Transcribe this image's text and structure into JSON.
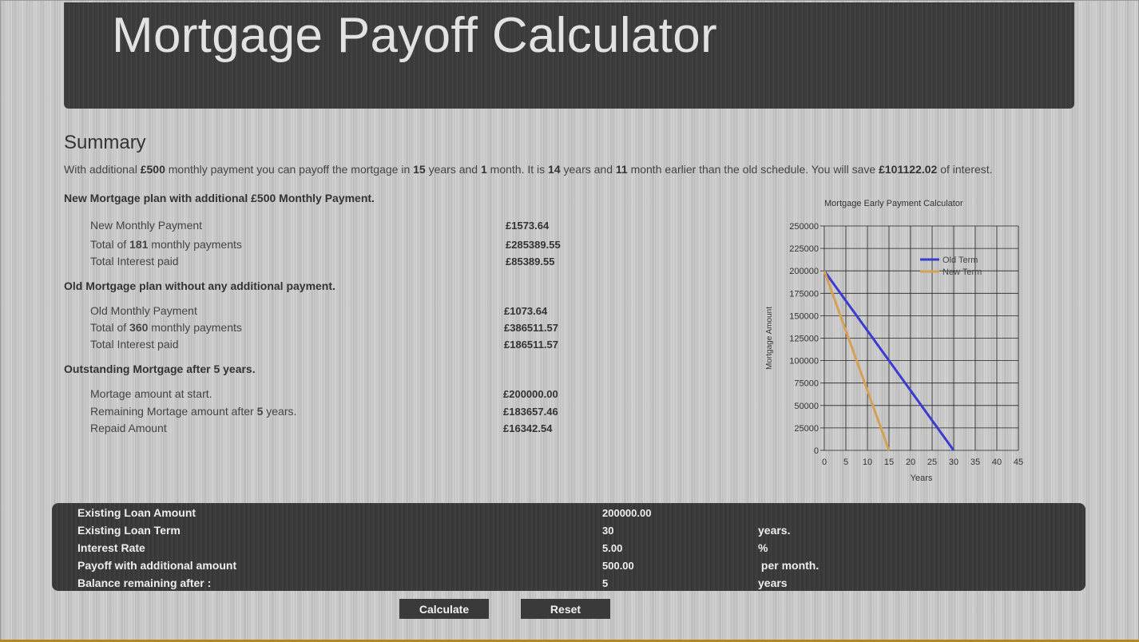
{
  "header": {
    "title": "Mortgage Payoff Calculator"
  },
  "summary": {
    "title": "Summary",
    "text": {
      "p1": "With additional ",
      "extra": "£500",
      "p2": "  monthly payment you can payoff the mortgage in ",
      "years": "15",
      "p3": "  years and ",
      "months": "1",
      "p4": "  month. It is ",
      "earlier_years": "14",
      "p5": "  years and ",
      "earlier_months": "11",
      "p6": "  month earlier than the old schedule. You will save ",
      "savings": "£101122.02",
      "p7": "  of interest."
    }
  },
  "new_plan": {
    "heading": "New Mortgage plan with additional £500  Monthly Payment.",
    "monthly_label": "New Monthly Payment",
    "monthly_value": "£1573.64",
    "total_prefix": "Total of ",
    "total_count": "181",
    "total_suffix": "  monthly payments",
    "total_value": "£285389.55",
    "interest_label": "Total Interest paid",
    "interest_value": "£85389.55"
  },
  "old_plan": {
    "heading": "Old Mortgage plan without any additional payment.",
    "monthly_label": "Old Monthly Payment",
    "monthly_value": "£1073.64",
    "total_prefix": "Total of ",
    "total_count": "360",
    "total_suffix": " monthly payments",
    "total_value": "£386511.57",
    "interest_label": "Total Interest paid",
    "interest_value": "£186511.57"
  },
  "outstanding": {
    "heading": "Outstanding Mortgage after 5  years.",
    "start_label": "Mortage amount at start.",
    "start_value": "£200000.00",
    "remaining_prefix": "Remaining Mortage amount after ",
    "remaining_years": "5",
    "remaining_suffix": "  years.",
    "remaining_value": "£183657.46",
    "repaid_label": "Repaid Amount",
    "repaid_value": "£16342.54"
  },
  "inputs": {
    "loan_amount_label": "Existing Loan Amount",
    "loan_amount_value": "200000.00",
    "loan_term_label": "Existing Loan Term",
    "loan_term_value": "30",
    "loan_term_unit": "years.",
    "rate_label": "Interest Rate",
    "rate_value": "5.00",
    "rate_unit": "%",
    "payoff_label": "Payoff with additional amount",
    "payoff_value": "500.00",
    "payoff_unit": " per month.",
    "balance_label": "Balance remaining after :",
    "balance_value": "5",
    "balance_unit": "years"
  },
  "buttons": {
    "calculate": "Calculate",
    "reset": "Reset"
  },
  "chart_data": {
    "type": "line",
    "title": "Mortgage Early Payment Calculator",
    "xlabel": "Years",
    "ylabel": "Mortgage Amount",
    "xlim": [
      0,
      45
    ],
    "ylim": [
      0,
      250000
    ],
    "x_ticks": [
      0,
      5,
      10,
      15,
      20,
      25,
      30,
      35,
      40,
      45
    ],
    "y_ticks": [
      0,
      25000,
      50000,
      75000,
      100000,
      125000,
      150000,
      175000,
      200000,
      225000,
      250000
    ],
    "grid": true,
    "legend_position": "top-right",
    "series": [
      {
        "name": "Old Term",
        "color": "#3b3bd0",
        "x": [
          0,
          30
        ],
        "y": [
          200000,
          0
        ]
      },
      {
        "name": "New Term",
        "color": "#d4a055",
        "x": [
          0,
          15
        ],
        "y": [
          200000,
          0
        ]
      }
    ]
  }
}
